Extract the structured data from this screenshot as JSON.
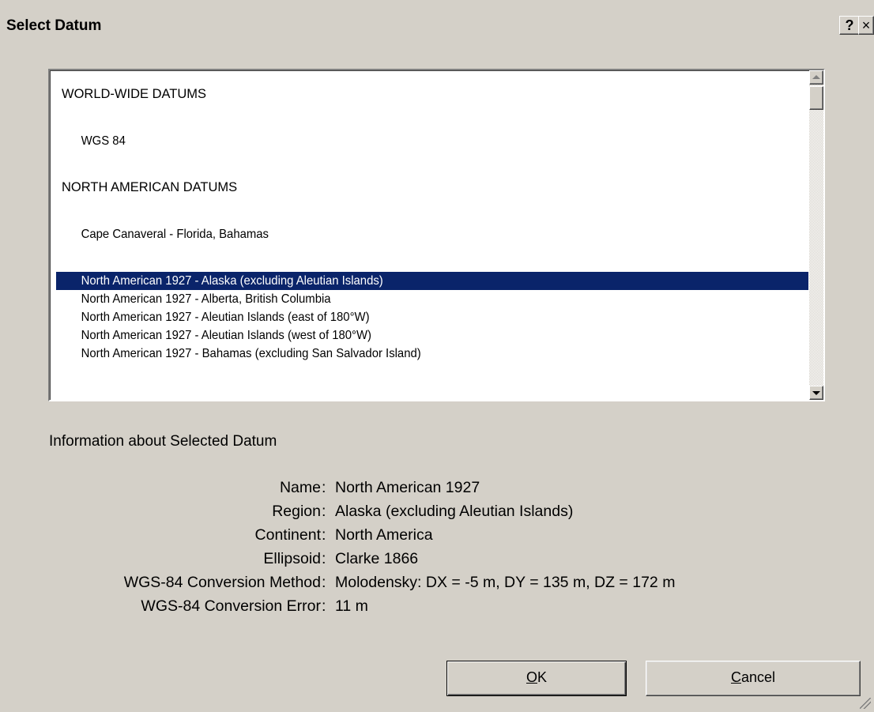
{
  "window": {
    "title": "Select Datum",
    "help_label": "?",
    "close_label": "×"
  },
  "datum_list": [
    {
      "label": "WORLD-WIDE DATUMS",
      "type": "heading",
      "selected": false
    },
    {
      "label": "WGS 84",
      "type": "entry",
      "selected": false
    },
    {
      "label": "NORTH AMERICAN DATUMS",
      "type": "heading",
      "selected": false
    },
    {
      "label": "Cape Canaveral - Florida, Bahamas",
      "type": "entry",
      "selected": false
    },
    {
      "label": "North American 1927 - Alaska (excluding Aleutian Islands)",
      "type": "entry",
      "selected": true
    },
    {
      "label": "North American 1927 - Alberta, British Columbia",
      "type": "entry",
      "selected": false
    },
    {
      "label": "North American 1927 - Aleutian Islands (east of 180°W)",
      "type": "entry",
      "selected": false
    },
    {
      "label": "North American 1927 - Aleutian Islands (west of 180°W)",
      "type": "entry",
      "selected": false
    },
    {
      "label": "North American 1927 - Bahamas (excluding San Salvador Island)",
      "type": "entry",
      "selected": false
    }
  ],
  "info": {
    "header": "Information about Selected Datum",
    "separator": ":",
    "rows": [
      {
        "label": "Name",
        "value": "North American 1927"
      },
      {
        "label": "Region",
        "value": "Alaska (excluding Aleutian Islands)"
      },
      {
        "label": "Continent",
        "value": "North America"
      },
      {
        "label": "Ellipsoid",
        "value": "Clarke 1866"
      },
      {
        "label": "WGS-84 Conversion Method",
        "value": "Molodensky: DX = -5 m, DY = 135 m, DZ = 172 m"
      },
      {
        "label": "WGS-84 Conversion Error",
        "value": "11 m"
      }
    ]
  },
  "buttons": {
    "ok_mnemonic": "O",
    "ok_rest": "K",
    "cancel_mnemonic": "C",
    "cancel_rest": "ancel"
  },
  "colors": {
    "dialog_background": "#d4d0c8",
    "selection_background": "#0a246a",
    "selection_text": "#ffffff"
  }
}
